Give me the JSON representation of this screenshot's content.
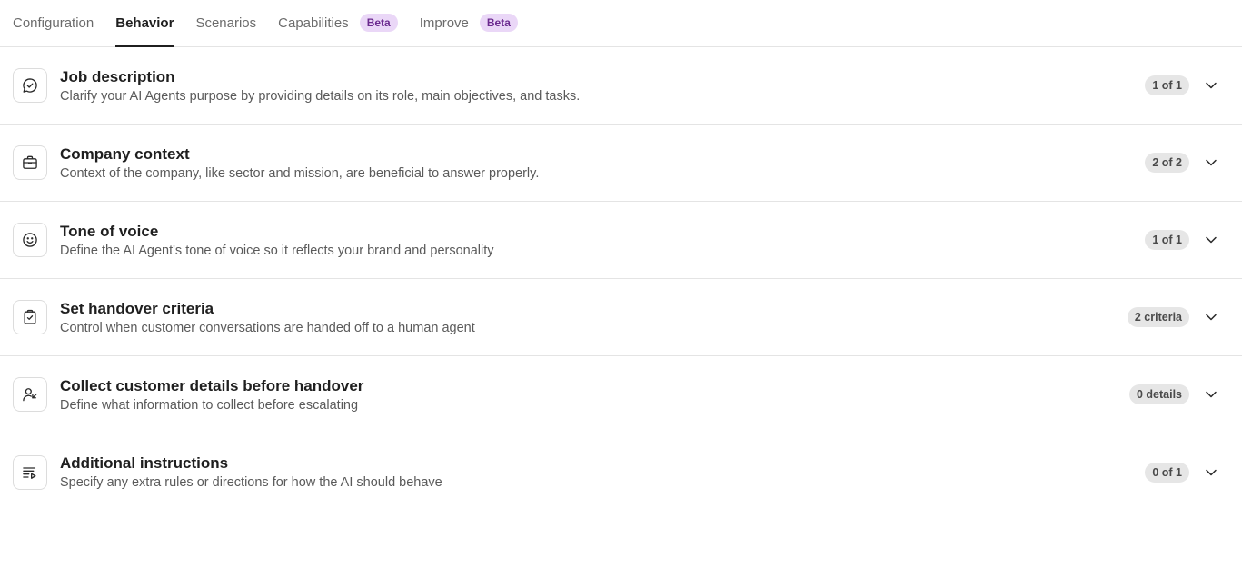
{
  "tabs": [
    {
      "label": "Configuration",
      "badge": ""
    },
    {
      "label": "Behavior",
      "badge": ""
    },
    {
      "label": "Scenarios",
      "badge": ""
    },
    {
      "label": "Capabilities",
      "badge": "Beta"
    },
    {
      "label": "Improve",
      "badge": "Beta"
    }
  ],
  "active_tab": "Behavior",
  "colors": {
    "badge_bg": "#ead7f7",
    "badge_text": "#6b2a8f",
    "count_bg": "#e6e6e6"
  },
  "sections": [
    {
      "icon": "chat-check-icon",
      "title": "Job description",
      "description": "Clarify your AI Agents purpose by providing details on its role, main objectives, and tasks.",
      "count": "1 of 1"
    },
    {
      "icon": "briefcase-icon",
      "title": "Company context",
      "description": "Context of the company, like sector and mission, are beneficial to answer properly.",
      "count": "2 of 2"
    },
    {
      "icon": "smiley-icon",
      "title": "Tone of voice",
      "description": "Define the AI Agent's tone of voice so it reflects your brand and personality",
      "count": "1 of 1"
    },
    {
      "icon": "clipboard-check-icon",
      "title": "Set handover criteria",
      "description": "Control when customer conversations are handed off to a human agent",
      "count": "2 criteria"
    },
    {
      "icon": "user-arrow-icon",
      "title": "Collect customer details before handover",
      "description": "Define what information to collect before escalating",
      "count": "0 details"
    },
    {
      "icon": "list-play-icon",
      "title": "Additional instructions",
      "description": "Specify any extra rules or directions for how the AI should behave",
      "count": "0 of 1"
    }
  ]
}
